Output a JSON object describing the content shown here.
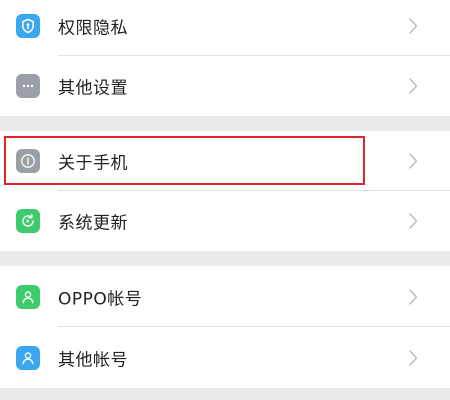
{
  "settings": {
    "items": [
      {
        "label": "权限隐私",
        "icon": "shield-icon",
        "color": "#3aa7f0"
      },
      {
        "label": "其他设置",
        "icon": "more-dots-icon",
        "color": "#9aa0a6"
      },
      {
        "label": "关于手机",
        "icon": "info-icon",
        "color": "#9aa0a6"
      },
      {
        "label": "系统更新",
        "icon": "update-icon",
        "color": "#3dcb6b"
      },
      {
        "label": "OPPO帐号",
        "icon": "user-icon",
        "color": "#3dcb6b"
      },
      {
        "label": "其他帐号",
        "icon": "user-icon",
        "color": "#3aa7f0"
      }
    ]
  },
  "highlight": {
    "target": "关于手机",
    "color": "#e0262c"
  }
}
